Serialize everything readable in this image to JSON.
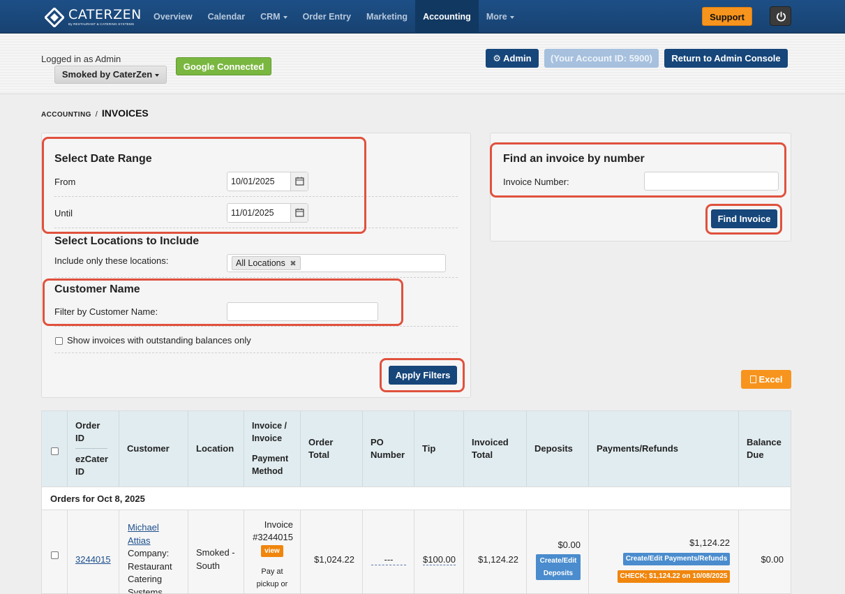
{
  "nav": {
    "logo_name": "CATERZEN",
    "logo_tagline": "By RESTAURANT & CATERING SYSTEMS",
    "items": [
      {
        "label": "Overview"
      },
      {
        "label": "Calendar"
      },
      {
        "label": "CRM"
      },
      {
        "label": "Order Entry"
      },
      {
        "label": "Marketing"
      },
      {
        "label": "Accounting"
      },
      {
        "label": "More"
      }
    ],
    "support_label": "Support",
    "colors": {
      "navbar": "#1b4a7e",
      "support": "#f7941d"
    }
  },
  "account": {
    "logged_in_text": "Logged in as Admin",
    "store_name": "Smoked by CaterZen",
    "google_label": "Google Connected",
    "admin_label": "Admin",
    "account_id_label": "(Your Account ID: 5900)",
    "return_label": "Return to Admin Console"
  },
  "breadcrumb": {
    "section": "ACCOUNTING",
    "sep": "/",
    "page": "INVOICES"
  },
  "filters": {
    "date_heading": "Select Date Range",
    "from_label": "From",
    "from_value": "10/01/2025",
    "until_label": "Until",
    "until_value": "11/01/2025",
    "locations_heading": "Select Locations to Include",
    "locations_label": "Include only these locations:",
    "location_tag": "All Locations",
    "customer_heading": "Customer Name",
    "customer_label": "Filter by Customer Name:",
    "customer_value": "",
    "outstanding_label": "Show invoices with outstanding balances only",
    "apply_label": "Apply Filters"
  },
  "find": {
    "heading": "Find an invoice by number",
    "label": "Invoice Number:",
    "value": "",
    "button_label": "Find Invoice"
  },
  "excel_label": "Excel",
  "table": {
    "headers": {
      "order_id": "Order ID",
      "ezcater_id": "ezCater ID",
      "customer": "Customer",
      "location": "Location",
      "invoice": "Invoice / Invoice",
      "payment_method": "Payment Method",
      "order_total": "Order Total",
      "po_number": "PO Number",
      "tip": "Tip",
      "invoiced_total": "Invoiced Total",
      "deposits": "Deposits",
      "payments": "Payments/Refunds",
      "balance_due": "Balance Due"
    },
    "group_label": "Orders for Oct 8, 2025",
    "row": {
      "order_id": "3244015",
      "customer_name": "Michael Attias",
      "customer_company": "Company: Restaurant Catering Systems",
      "location": "Smoked - South",
      "invoice_number": "Invoice #3244015",
      "view_label": "view",
      "payment_method": "Pay at pickup or",
      "order_total": "$1,024.22",
      "po_number": "---",
      "tip": "$100.00",
      "invoiced_total": "$1,124.22",
      "deposits_amount": "$0.00",
      "deposits_button": "Create/Edit Deposits",
      "payments_amount": "$1,124.22",
      "payments_button": "Create/Edit Payments/Refunds",
      "payment_entry": "CHECK; $1,124.22 on 10/08/2025",
      "balance_due": "$0.00"
    }
  }
}
